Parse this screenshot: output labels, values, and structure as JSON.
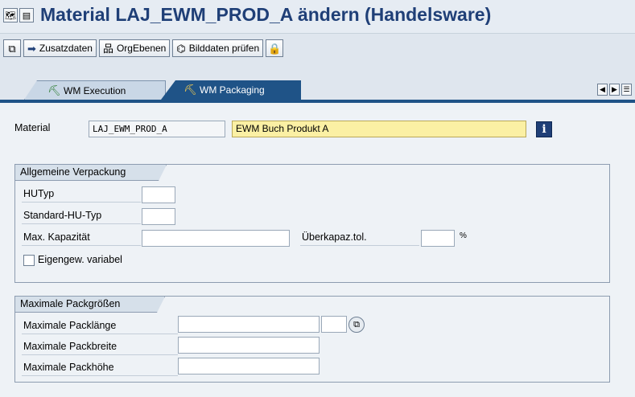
{
  "title": "Material LAJ_EWM_PROD_A ändern (Handelsware)",
  "title_icons": [
    "🗺",
    "▤"
  ],
  "toolbar": {
    "other_views_icon": "⧉",
    "zusatzdaten_label": "Zusatzdaten",
    "zusatzdaten_icon": "➡",
    "orgebenen_label": "OrgEbenen",
    "orgebenen_icon": "品",
    "bilddaten_label": "Bilddaten prüfen",
    "bilddaten_icon": "⌬",
    "lock_icon": "🔒"
  },
  "tabs": [
    {
      "label": "WM Execution",
      "icon": "⛏"
    },
    {
      "label": "WM Packaging",
      "icon": "⛏"
    }
  ],
  "scroll_icons": [
    "◀",
    "▶",
    "☰"
  ],
  "material": {
    "label": "Material",
    "value": "LAJ_EWM_PROD_A",
    "description": "EWM Buch Produkt A",
    "info_icon": "i"
  },
  "allgemeine": {
    "title": "Allgemeine Verpackung",
    "hutyp_label": "HUTyp",
    "hutyp_value": "",
    "standard_hu_label": "Standard-HU-Typ",
    "standard_hu_value": "",
    "max_kap_label": "Max. Kapazität",
    "max_kap_value": "",
    "ueberkap_label": "Überkapaz.tol.",
    "ueberkap_value": "",
    "percent": "%",
    "eigengew_label": "Eigengew. variabel",
    "eigengew_checked": false
  },
  "maximale": {
    "title": "Maximale Packgrößen",
    "laenge_label": "Maximale Packlänge",
    "laenge_value": "",
    "laenge_unit": "",
    "f4_icon": "⧉",
    "breite_label": "Maximale Packbreite",
    "breite_value": "",
    "hoehe_label": "Maximale Packhöhe",
    "hoehe_value": ""
  }
}
